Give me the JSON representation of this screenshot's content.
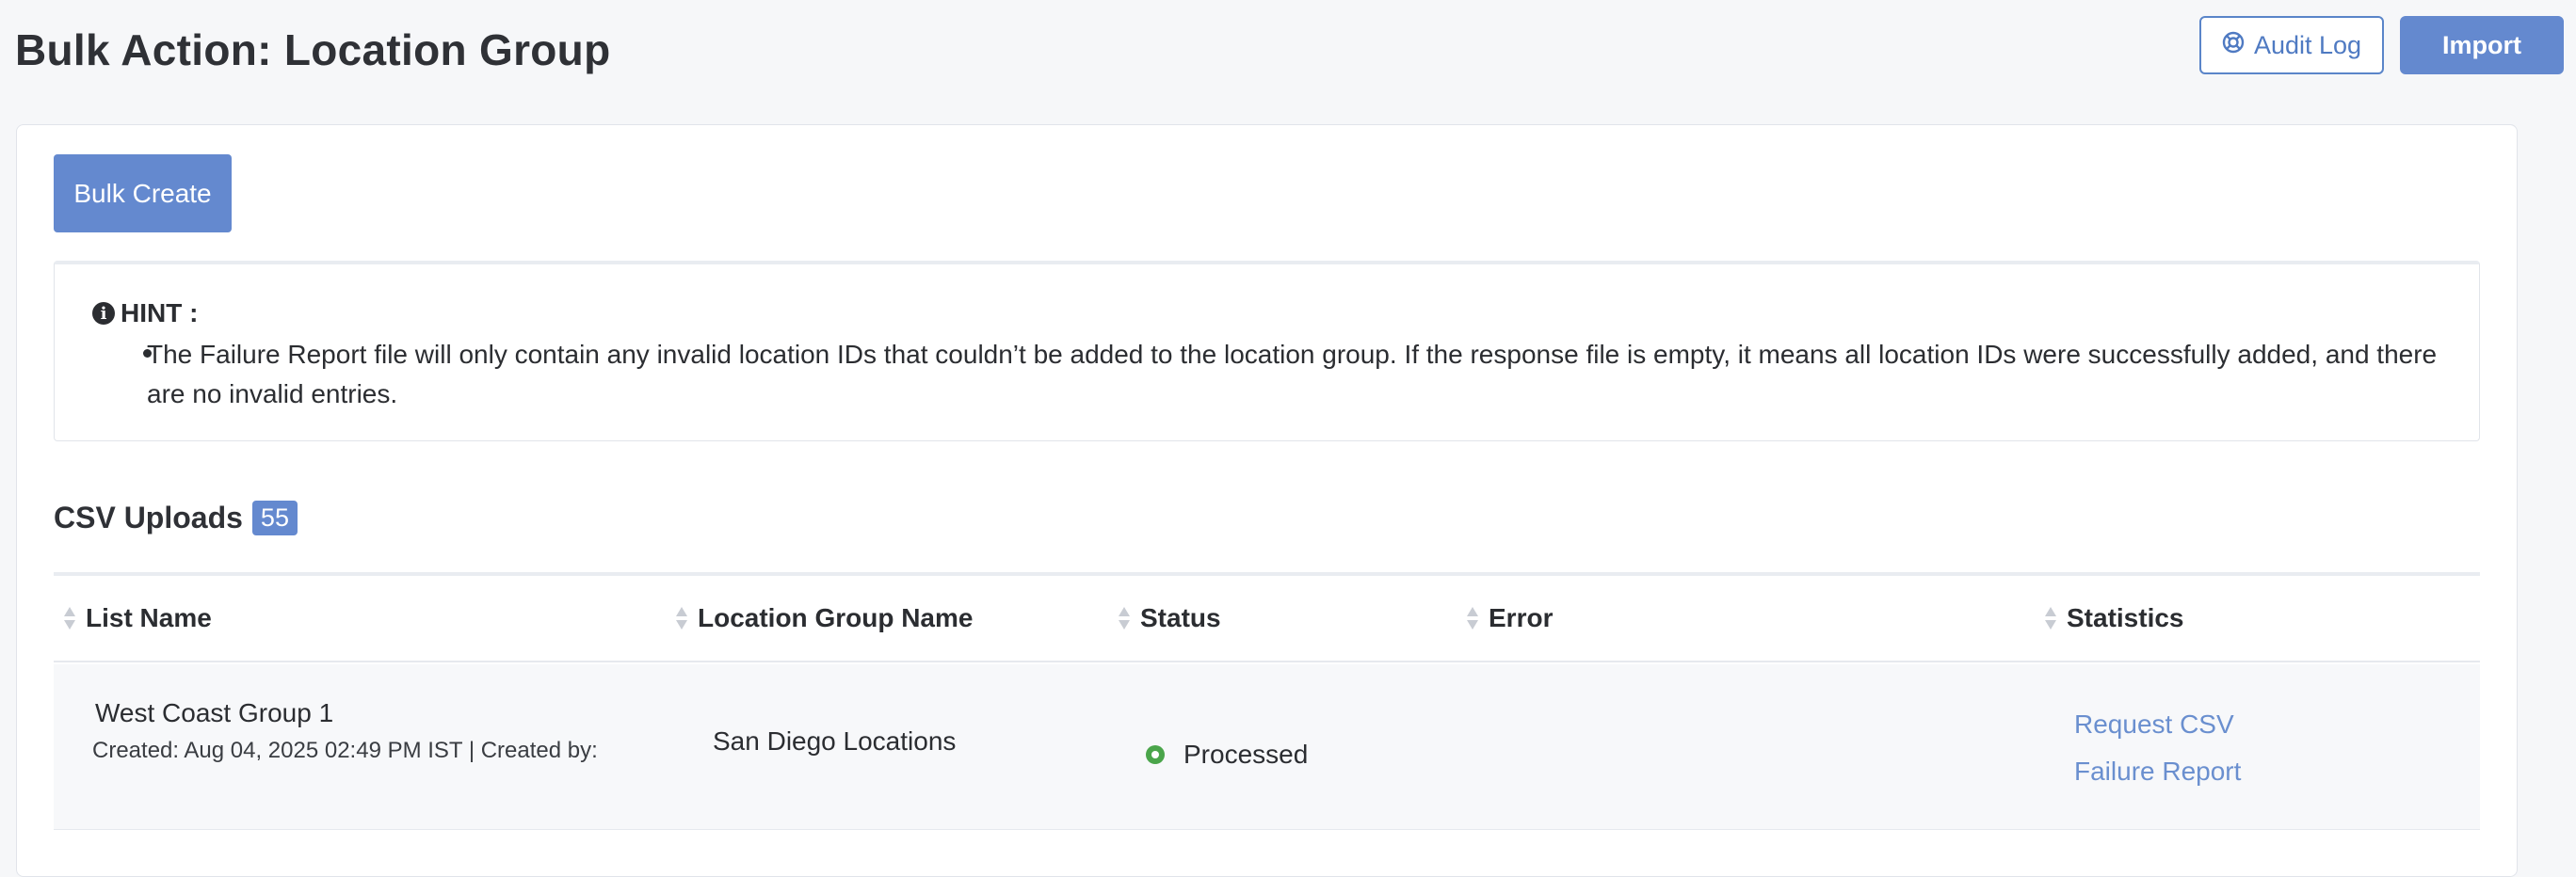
{
  "header": {
    "title": "Bulk Action: Location Group",
    "audit_log_label": "Audit Log",
    "import_label": "Import",
    "audit_icon": "lifebuoy-icon"
  },
  "toolbar": {
    "bulk_create_label": "Bulk Create"
  },
  "hint": {
    "title": "HINT :",
    "icon": "info-icon",
    "text": "The Failure Report file will only contain any invalid location IDs that couldn’t be added to the location group. If the response file is empty, it means all location IDs were successfully added, and there are no invalid entries."
  },
  "csv_uploads": {
    "title": "CSV Uploads",
    "count": "55",
    "columns": [
      "List Name",
      "Location Group Name",
      "Status",
      "Error",
      "Statistics"
    ],
    "rows": [
      {
        "list_name": "West Coast Group 1",
        "meta": "Created: Aug 04, 2025 02:49 PM IST | Created by:",
        "location_group": "San Diego Locations",
        "status": "Processed",
        "error": "",
        "request_csv": "Request CSV",
        "failure_report": "Failure Report"
      }
    ]
  },
  "colors": {
    "accent": "#6489cf",
    "link": "#6a8fcf",
    "success": "#4aa54a",
    "page_bg": "#f6f7f9"
  }
}
